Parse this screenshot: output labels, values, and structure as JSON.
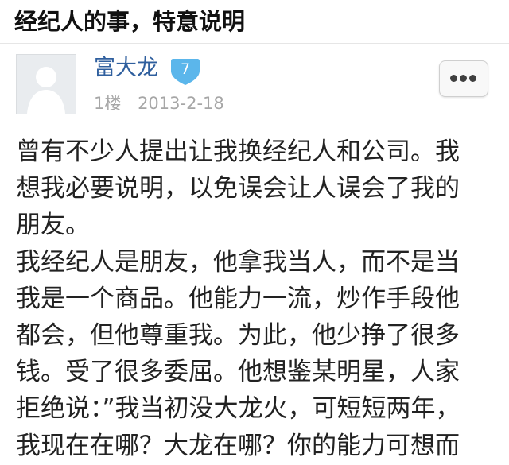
{
  "post": {
    "title": "经纪人的事，特意说明"
  },
  "author": {
    "name": "富大龙",
    "level": "7",
    "avatar_icon": "default-user-avatar-icon"
  },
  "meta": {
    "floor": "1楼",
    "date": "2013-2-18"
  },
  "actions": {
    "more_icon": "more-dots-icon"
  },
  "content_lines": [
    "曾有不少人提出让我换经纪人和公司。我",
    "想我必要说明，以免误会让人误会了我的",
    "朋友。",
    "我经纪人是朋友，他拿我当人，而不是当",
    "我是一个商品。他能力一流，炒作手段他",
    "都会，但他尊重我。为此，他少挣了很多",
    "钱。受了很多委屈。他想鉴某明星，人家",
    "拒绝说：”我当初没大龙火，可短短两年，",
    "我现在在哪？大龙在哪？你的能力可想而"
  ],
  "colors": {
    "author_link": "#2f5f9e",
    "level_badge": "#5bb6eb",
    "meta_text": "#a6a6a6"
  }
}
